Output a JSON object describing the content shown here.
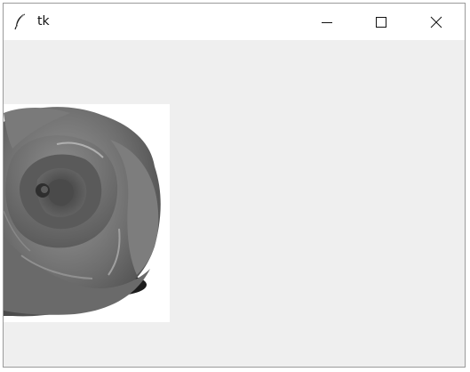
{
  "window": {
    "title": "tk"
  },
  "titlebar": {
    "app_icon": "feather-icon",
    "minimize_icon": "minimize-icon",
    "maximize_icon": "maximize-icon",
    "close_icon": "close-icon"
  },
  "content": {
    "image": "rose-image",
    "image_background": "#ffffff",
    "window_background": "#efefef"
  }
}
